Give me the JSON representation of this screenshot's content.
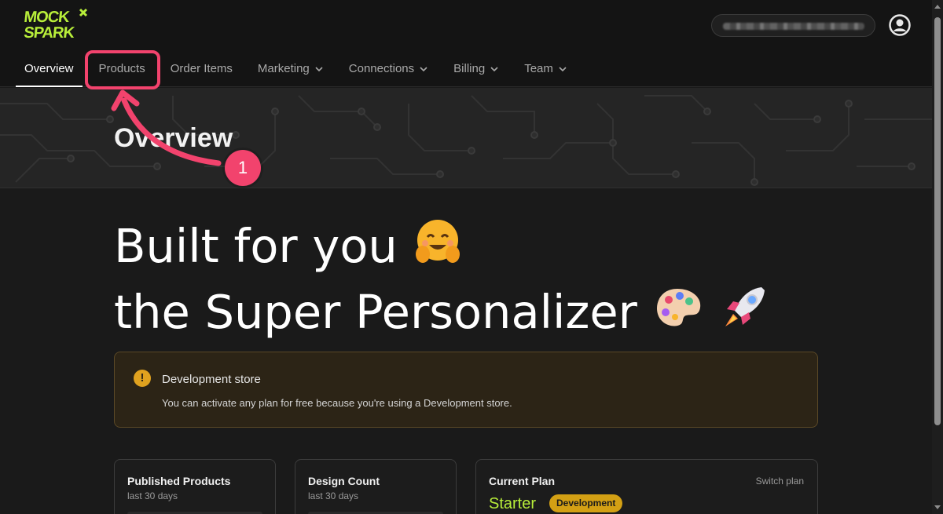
{
  "app": {
    "logo_text": "MOCK SPARK",
    "store_name": "",
    "account_icon": "account-circle-icon"
  },
  "nav": {
    "items": [
      {
        "label": "Overview",
        "active": true,
        "dropdown": false
      },
      {
        "label": "Products",
        "active": false,
        "dropdown": false
      },
      {
        "label": "Order Items",
        "active": false,
        "dropdown": false
      },
      {
        "label": "Marketing",
        "active": false,
        "dropdown": true
      },
      {
        "label": "Connections",
        "active": false,
        "dropdown": true
      },
      {
        "label": "Billing",
        "active": false,
        "dropdown": true
      },
      {
        "label": "Team",
        "active": false,
        "dropdown": true
      }
    ]
  },
  "page": {
    "title": "Overview"
  },
  "hero": {
    "line1": "Built for you",
    "line2": "the Super Personalizer",
    "emoji1": "hugging-face-emoji",
    "emoji2": "artist-palette-emoji",
    "emoji3": "rocket-emoji"
  },
  "notice": {
    "icon": "warning-icon",
    "icon_glyph": "!",
    "title": "Development store",
    "body": "You can activate any plan for free because you're using a Development store."
  },
  "cards": [
    {
      "title": "Published Products",
      "subtitle": "last 30 days"
    },
    {
      "title": "Design Count",
      "subtitle": "last 30 days"
    },
    {
      "title": "Current Plan",
      "link": "Switch plan",
      "plan": "Starter",
      "badge": "Development"
    }
  ],
  "annotation": {
    "step_number": "1",
    "color": "#f2436d"
  },
  "colors": {
    "accent_green": "#b8ee3a",
    "badge_gold": "#d3a014",
    "warning": "#e0a21f",
    "background": "#1a1a1a"
  }
}
